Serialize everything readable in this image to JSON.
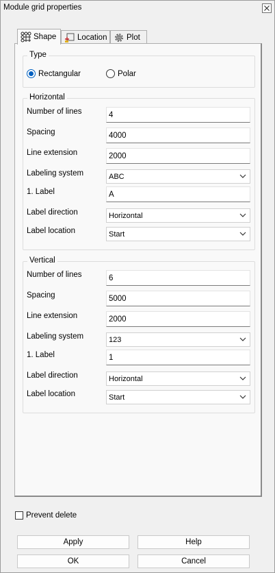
{
  "window": {
    "title": "Module grid properties"
  },
  "tabs": [
    {
      "label": "Shape",
      "icon": "grid-icon"
    },
    {
      "label": "Location",
      "icon": "location-icon"
    },
    {
      "label": "Plot",
      "icon": "gear-icon"
    }
  ],
  "type_group": {
    "title": "Type",
    "options": [
      {
        "label": "Rectangular",
        "selected": true
      },
      {
        "label": "Polar",
        "selected": false
      }
    ]
  },
  "horizontal": {
    "title": "Horizontal",
    "number_of_lines_label": "Number of lines",
    "number_of_lines": "4",
    "spacing_label": "Spacing",
    "spacing": "4000",
    "line_extension_label": "Line extension",
    "line_extension": "2000",
    "labeling_system_label": "Labeling system",
    "labeling_system": "ABC",
    "first_label_label": "1. Label",
    "first_label": "A",
    "label_direction_label": "Label direction",
    "label_direction": "Horizontal",
    "label_location_label": "Label location",
    "label_location": "Start"
  },
  "vertical": {
    "title": "Vertical",
    "number_of_lines_label": "Number of lines",
    "number_of_lines": "6",
    "spacing_label": "Spacing",
    "spacing": "5000",
    "line_extension_label": "Line extension",
    "line_extension": "2000",
    "labeling_system_label": "Labeling system",
    "labeling_system": "123",
    "first_label_label": "1. Label",
    "first_label": "1",
    "label_direction_label": "Label direction",
    "label_direction": "Horizontal",
    "label_location_label": "Label location",
    "label_location": "Start"
  },
  "prevent_delete": {
    "label": "Prevent delete",
    "checked": false
  },
  "buttons": {
    "apply": "Apply",
    "help": "Help",
    "ok": "OK",
    "cancel": "Cancel"
  },
  "colors": {
    "radio_accent": "#0060c0",
    "panel_bg": "#f9f9f9",
    "window_bg": "#f0f0f0"
  }
}
